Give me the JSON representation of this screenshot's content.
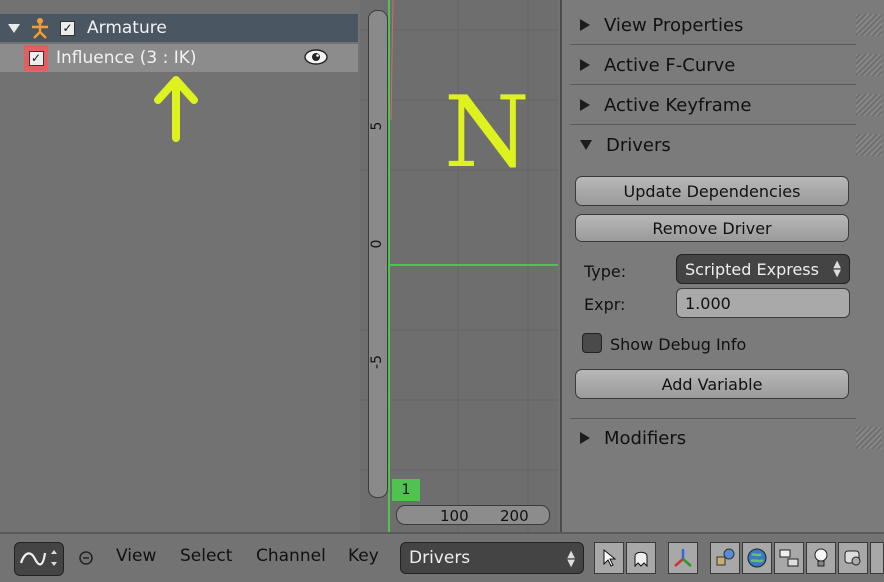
{
  "outliner": {
    "armature_label": "Armature",
    "influence_label": "Influence (3 : IK)"
  },
  "graph": {
    "y_ticks": [
      "5",
      "0",
      "-5"
    ],
    "x_ticks": [
      "100",
      "200"
    ],
    "current_frame": "1",
    "overlay_letter": "N",
    "overlay_color": "#ddf21e"
  },
  "properties": {
    "panels": {
      "view_properties": "View Properties",
      "active_fcurve": "Active F-Curve",
      "active_keyframe": "Active Keyframe",
      "drivers": "Drivers",
      "modifiers": "Modifiers"
    },
    "buttons": {
      "update_dependencies": "Update Dependencies",
      "remove_driver": "Remove Driver",
      "add_variable": "Add Variable"
    },
    "type_label": "Type:",
    "type_value": "Scripted Express",
    "expr_label": "Expr:",
    "expr_value": "1.000",
    "show_debug_label": "Show Debug Info"
  },
  "toolbar": {
    "menus": [
      "View",
      "Select",
      "Channel",
      "Key"
    ],
    "mode_value": "Drivers"
  },
  "colors": {
    "accent_green": "#4fc24f",
    "annotation": "#ddf21e",
    "header_row": "#4a5662"
  }
}
